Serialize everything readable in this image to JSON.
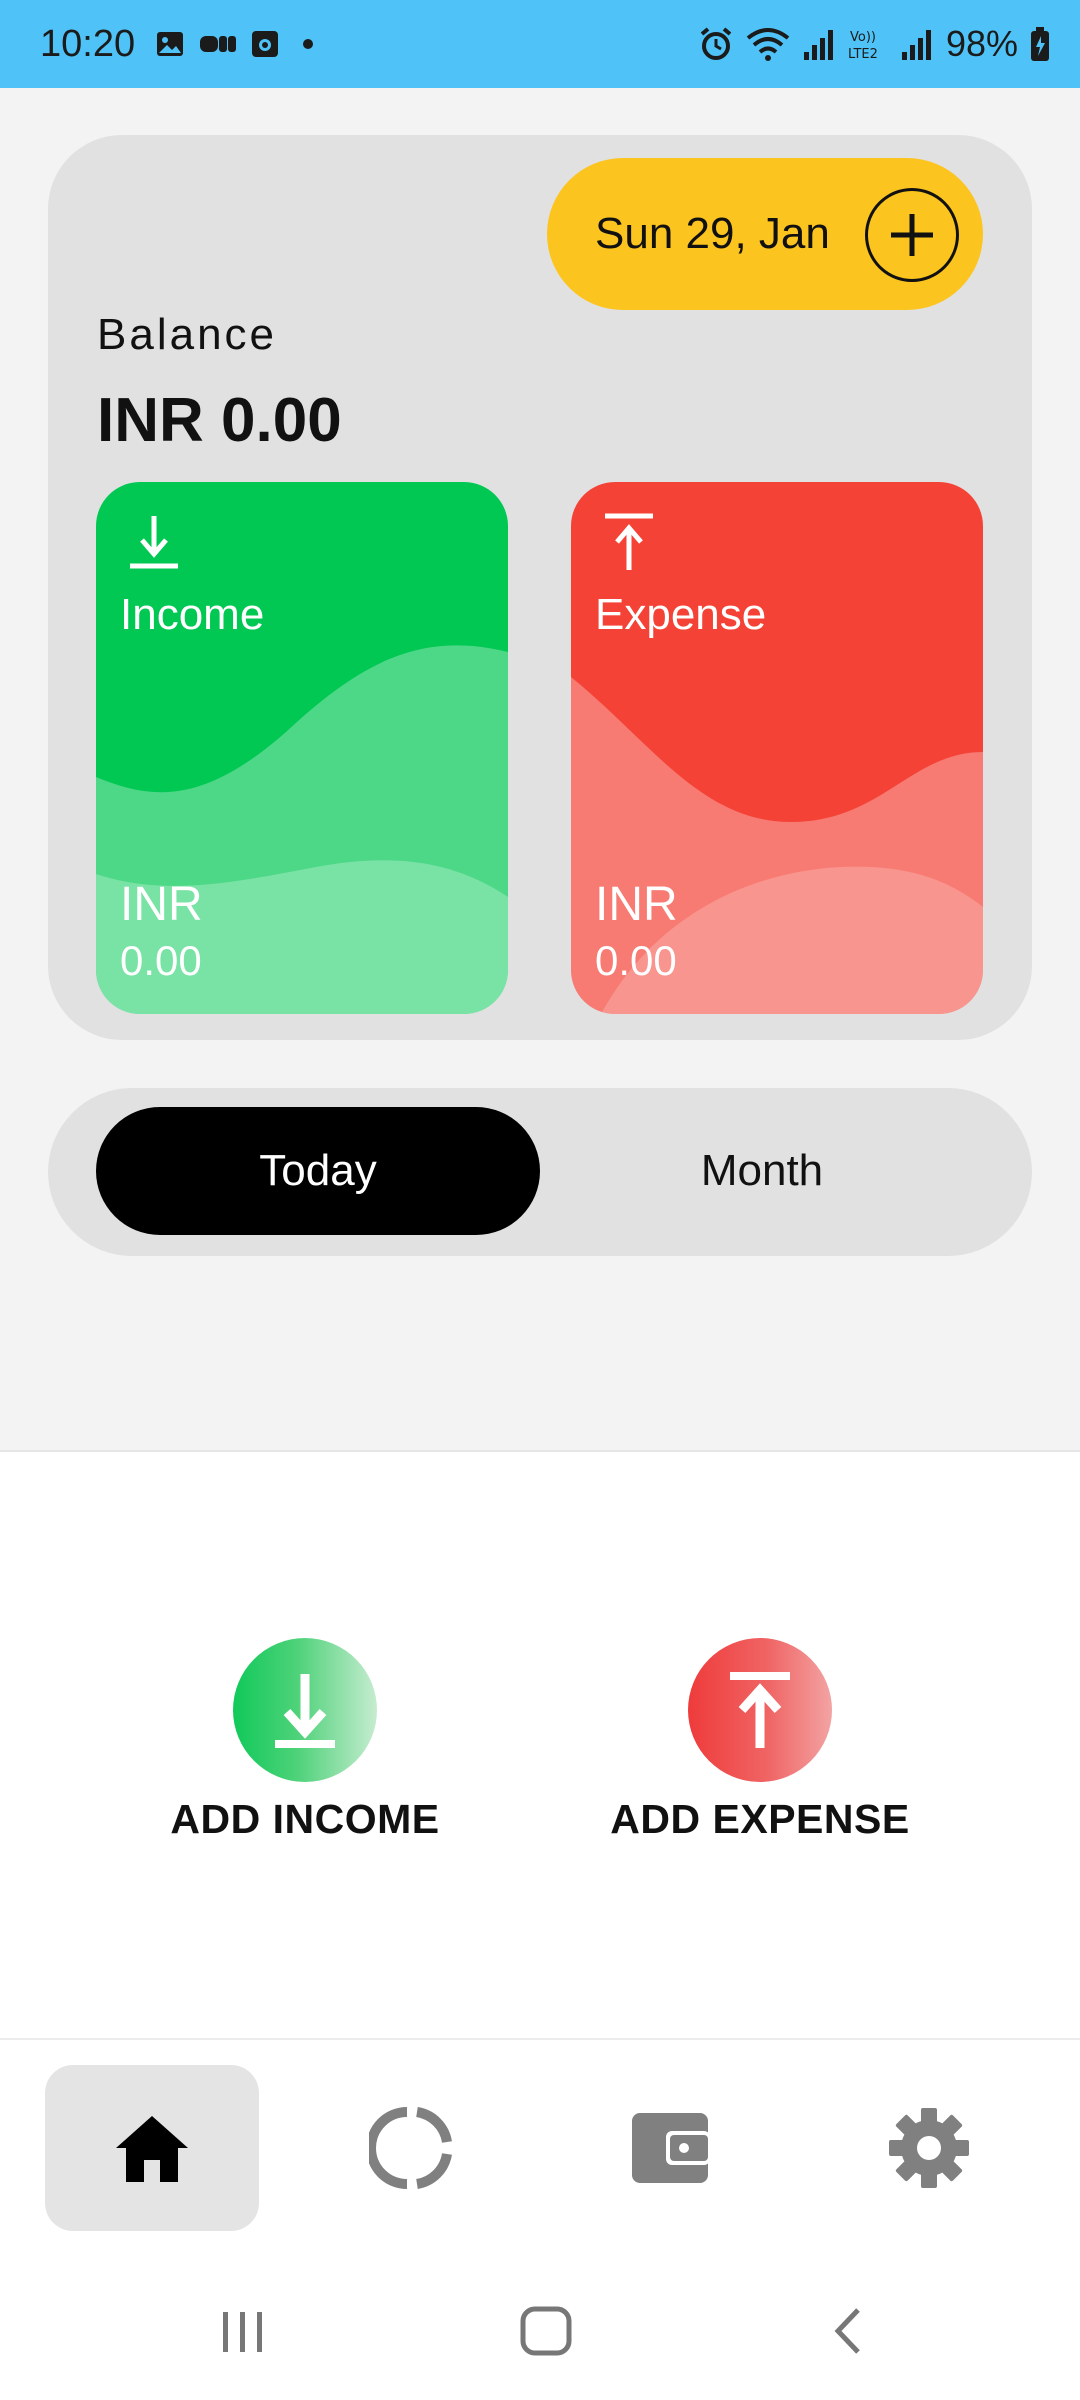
{
  "status_bar": {
    "time": "10:20",
    "battery": "98%",
    "icons_left": [
      "gallery-icon",
      "media-icon",
      "app-icon",
      "dot-icon"
    ],
    "icons_right": [
      "alarm-icon",
      "wifi-icon",
      "signal-icon",
      "volte-icon",
      "signal-icon",
      "battery-icon"
    ],
    "color": "#4fc3f7"
  },
  "header": {
    "date": "Sun 29, Jan",
    "add_icon": "plus-circle-icon",
    "balance_label": "Balance",
    "balance_value": "INR 0.00"
  },
  "tiles": {
    "income": {
      "title": "Income",
      "currency": "INR",
      "amount": "0.00",
      "color": "#00c853",
      "icon": "download-icon"
    },
    "expense": {
      "title": "Expense",
      "currency": "INR",
      "amount": "0.00",
      "color": "#f44336",
      "icon": "upload-icon"
    }
  },
  "period_toggle": {
    "options": [
      "Today",
      "Month"
    ],
    "selected": "Today"
  },
  "actions": {
    "add_income": "ADD INCOME",
    "add_expense": "ADD EXPENSE"
  },
  "bottom_nav": {
    "items": [
      {
        "icon": "home-icon",
        "active": true
      },
      {
        "icon": "stats-icon",
        "active": false
      },
      {
        "icon": "wallet-icon",
        "active": false
      },
      {
        "icon": "settings-icon",
        "active": false
      }
    ]
  },
  "system_nav": [
    "recents-icon",
    "home-circle-icon",
    "back-icon"
  ]
}
